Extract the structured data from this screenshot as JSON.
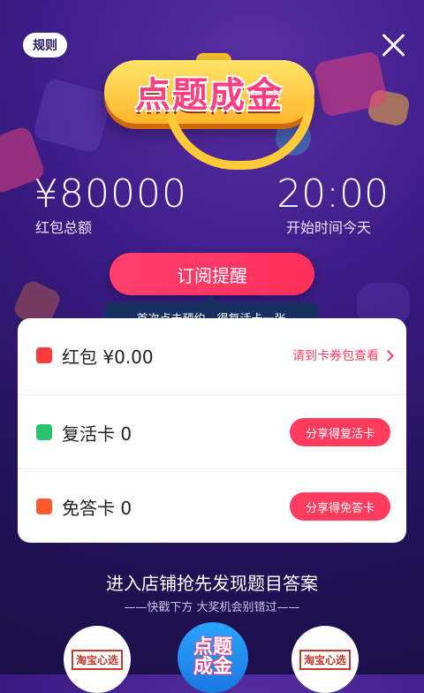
{
  "header": {
    "rule_label": "规则",
    "logo_text": "点题成金"
  },
  "prize": {
    "amount": "¥80000",
    "amount_label": "红包总额",
    "time": "20:00",
    "time_label": "开始时间今天"
  },
  "cta": {
    "subscribe_label": "订阅提醒",
    "tooltip": "首次点击预约，得复活卡一张"
  },
  "card": {
    "rows": [
      {
        "title": "红包  ¥0.00",
        "action": "请到卡券包查看",
        "icon": "red-envelope-icon",
        "icon_color": "#ff3b3b"
      },
      {
        "title": "复活卡  0",
        "action": "分享得复活卡",
        "icon": "leaf-icon",
        "icon_color": "#27c46b"
      },
      {
        "title": "免答卡  0",
        "action": "分享得免答卡",
        "icon": "shield-icon",
        "icon_color": "#ff5a2b"
      }
    ]
  },
  "footer": {
    "headline": "进入店铺抢先发现题目答案",
    "subline": "——快戳下方 大奖机会别错过——",
    "shops": [
      {
        "label": "淘宝心选"
      },
      {
        "label": "点题成金"
      },
      {
        "label": "淘宝心选"
      }
    ]
  },
  "colors": {
    "accent": "#ff3b5f",
    "background": "#3b1c86",
    "tooltip": "#18305f"
  }
}
